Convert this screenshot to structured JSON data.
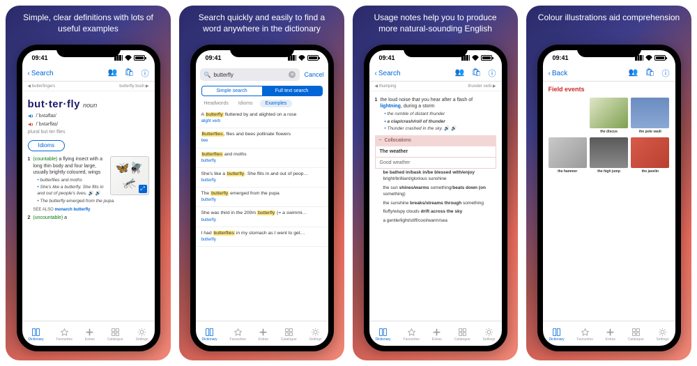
{
  "status_time": "09:41",
  "tabs": [
    "Dictionary",
    "Favourites",
    "Extras",
    "Catalogue",
    "Settings"
  ],
  "p1": {
    "caption": "Simple, clear definitions with lots of useful examples",
    "back": "Search",
    "prev": "butterfingers",
    "next": "butterfly bush",
    "headword": "but·ter·fly",
    "pos": "noun",
    "ipa_uk": "/ˈbʌtəflaɪ/",
    "ipa_us": "/ˈbʌtərflaɪ/",
    "plural": "plural but·ter·flies",
    "idioms_btn": "Idioms",
    "sense_gram": "(countable)",
    "sense": "a flying insect with a long thin body and four large, usually brightly coloured, wings",
    "ex1": "butterflies and moths",
    "ex2": "She's like a butterfly. She flits in and out of people's lives.",
    "ex3": "The butterfly emerged from the pupa.",
    "see_also": "SEE ALSO",
    "see_also_link": "monarch butterfly",
    "sense2_gram": "(uncountable)",
    "sense2": "a"
  },
  "p2": {
    "caption": "Search quickly and easily to find a word anywhere in the dictionary",
    "query": "butterfly",
    "cancel": "Cancel",
    "seg_simple": "Simple search",
    "seg_full": "Full text search",
    "f_head": "Headwords",
    "f_idiom": "Idioms",
    "f_ex": "Examples",
    "r": [
      {
        "t": "A butterfly fluttered by and alighted on a rose",
        "s": "alight  verb"
      },
      {
        "t": "Butterflies, flies and bees pollinate flowers",
        "s": "bee"
      },
      {
        "t": "butterflies and moths",
        "s": "butterfly"
      },
      {
        "t": "She's like a butterfly. She flits in and out of peop…",
        "s": "butterfly"
      },
      {
        "t": "The butterfly emerged from the pupa",
        "s": "butterfly"
      },
      {
        "t": "She was third in the 200m butterfly (= a swimmi…",
        "s": "butterfly"
      },
      {
        "t": "I had butterflies in my stomach as I went to get…",
        "s": "butterfly"
      }
    ]
  },
  "p3": {
    "caption": "Usage notes help you to produce more natural-sounding English",
    "back": "Search",
    "prev": "thumping",
    "next": "thunder  verb",
    "def_pre": "the loud noise that you hear after a flash of ",
    "def_link": "lightning",
    "def_post": ", during a storm",
    "ex1": "the rumble of distant thunder",
    "ex2": "a clap/crash/roll of thunder",
    "ex3": "Thunder crashed in the sky.",
    "coll_h": "Collocations",
    "theme": "The weather",
    "sub1": "Good weather",
    "i1": "be bathed in/bask in/be blessed with/enjoy bright/brilliant/glorious sunshine",
    "i2": "the sun shines/warms something/beats down (on something)",
    "i3": "the sunshine breaks/streams through something",
    "i4": "fluffy/wispy clouds drift across the sky",
    "i5": "a gentle/light/stiff/cool/warm/sea"
  },
  "p4": {
    "caption": "Colour illustrations aid comprehension",
    "back": "Back",
    "title": "Field events",
    "cells": [
      {
        "l": "the discus",
        "bg": "linear-gradient(135deg,#dfe6c5,#7ea050)"
      },
      {
        "l": "the pole vault",
        "bg": "linear-gradient(180deg,#6a8cc0,#8aa8d4)"
      },
      {
        "l": "the hammer",
        "bg": "linear-gradient(135deg,#c9c9c9,#9a9a9a)"
      },
      {
        "l": "the high jump",
        "bg": "linear-gradient(180deg,#5a5a5a,#8a8a8a)"
      },
      {
        "l": "the javelin",
        "bg": "linear-gradient(135deg,#d85a4a,#b84030)"
      }
    ]
  }
}
